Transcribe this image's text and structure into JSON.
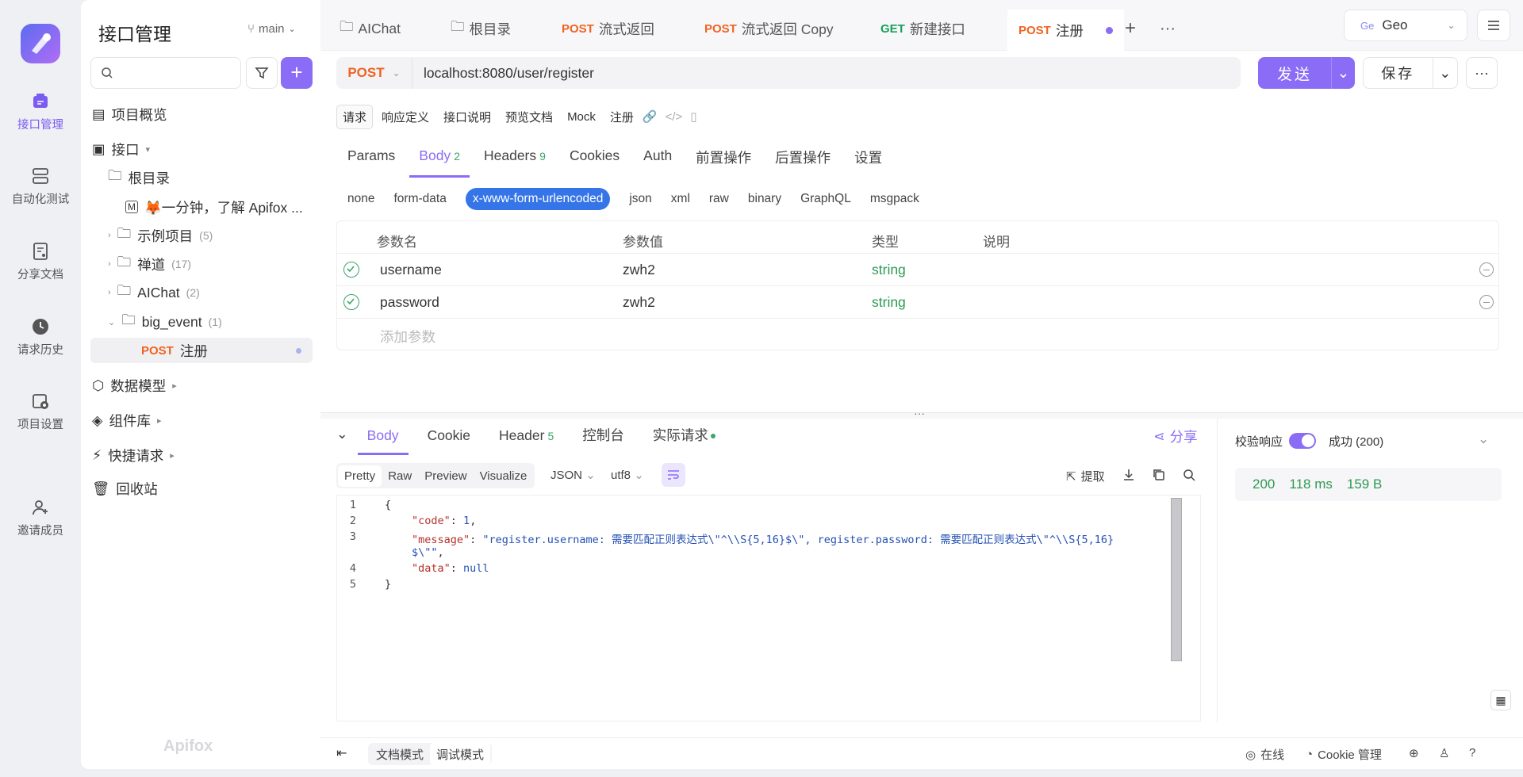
{
  "rail": {
    "items": [
      {
        "label": "接口管理",
        "icon": "api-icon"
      },
      {
        "label": "自动化测试",
        "icon": "automation-icon"
      },
      {
        "label": "分享文档",
        "icon": "share-doc-icon"
      },
      {
        "label": "请求历史",
        "icon": "history-icon"
      },
      {
        "label": "项目设置",
        "icon": "settings-icon"
      },
      {
        "label": "邀请成员",
        "icon": "invite-icon"
      }
    ]
  },
  "sidebar": {
    "title": "接口管理",
    "branch": "main",
    "overview": "项目概览",
    "api": "接口",
    "root": "根目录",
    "intro": "🦊一分钟，了解 Apifox ...",
    "folders": [
      {
        "name": "示例项目",
        "count": "(5)"
      },
      {
        "name": "禅道",
        "count": "(17)"
      },
      {
        "name": "AIChat",
        "count": "(2)"
      },
      {
        "name": "big_event",
        "count": "(1)"
      }
    ],
    "selected": {
      "method": "POST",
      "name": "注册"
    },
    "sections": [
      "数据模型",
      "组件库",
      "快捷请求",
      "回收站"
    ],
    "watermark": "Apifox"
  },
  "tabs": [
    {
      "method": "",
      "label": "AIChat"
    },
    {
      "method": "",
      "label": "根目录"
    },
    {
      "method": "POST",
      "label": "流式返回"
    },
    {
      "method": "POST",
      "label": "流式返回 Copy"
    },
    {
      "method": "GET",
      "label": "新建接口"
    },
    {
      "method": "POST",
      "label": "注册"
    }
  ],
  "env": {
    "badge": "Ge",
    "name": "Geo"
  },
  "request": {
    "method": "POST",
    "url": "localhost:8080/user/register",
    "send": "发送",
    "save": "保存"
  },
  "subtabs": [
    "请求",
    "响应定义",
    "接口说明",
    "预览文档",
    "Mock",
    "注册"
  ],
  "req_tabs": [
    {
      "label": "Params",
      "num": ""
    },
    {
      "label": "Body",
      "num": "2"
    },
    {
      "label": "Headers",
      "num": "9"
    },
    {
      "label": "Cookies",
      "num": ""
    },
    {
      "label": "Auth",
      "num": ""
    },
    {
      "label": "前置操作",
      "num": ""
    },
    {
      "label": "后置操作",
      "num": ""
    },
    {
      "label": "设置",
      "num": ""
    }
  ],
  "body_types": [
    "none",
    "form-data",
    "x-www-form-urlencoded",
    "json",
    "xml",
    "raw",
    "binary",
    "GraphQL",
    "msgpack"
  ],
  "params": {
    "headers": [
      "参数名",
      "参数值",
      "类型",
      "说明"
    ],
    "rows": [
      {
        "name": "username",
        "value": "zwh2",
        "type": "string"
      },
      {
        "name": "password",
        "value": "zwh2",
        "type": "string"
      }
    ],
    "add_placeholder": "添加参数"
  },
  "response": {
    "tabs": [
      {
        "label": "Body",
        "num": ""
      },
      {
        "label": "Cookie",
        "num": ""
      },
      {
        "label": "Header",
        "num": "5"
      },
      {
        "label": "控制台",
        "num": ""
      },
      {
        "label": "实际请求",
        "num": ""
      }
    ],
    "share": "分享",
    "formats": [
      "Pretty",
      "Raw",
      "Preview",
      "Visualize"
    ],
    "lang": "JSON",
    "encoding": "utf8",
    "extract": "提取",
    "line_numbers": [
      "1",
      "2",
      "3",
      "",
      "4",
      "5"
    ],
    "lines": {
      "open": "{",
      "code_key": "\"code\"",
      "code_val": "1",
      "msg_key": "\"message\"",
      "msg_val_1": "\"register.username: 需要匹配正则表达式\\\"^\\\\S{5,16}$\\\", register.password: 需要匹配正则表达式\\\"^\\\\S{5,16}",
      "msg_val_2": "$\\\"\"",
      "data_key": "\"data\"",
      "data_val": "null",
      "close": "}"
    },
    "verify_label": "校验响应",
    "success_label": "成功 (200)",
    "status": "200",
    "time": "118 ms",
    "size": "159 B"
  },
  "footer": {
    "modes": [
      "文档模式",
      "调试模式"
    ],
    "online": "在线",
    "cookie": "Cookie 管理"
  }
}
